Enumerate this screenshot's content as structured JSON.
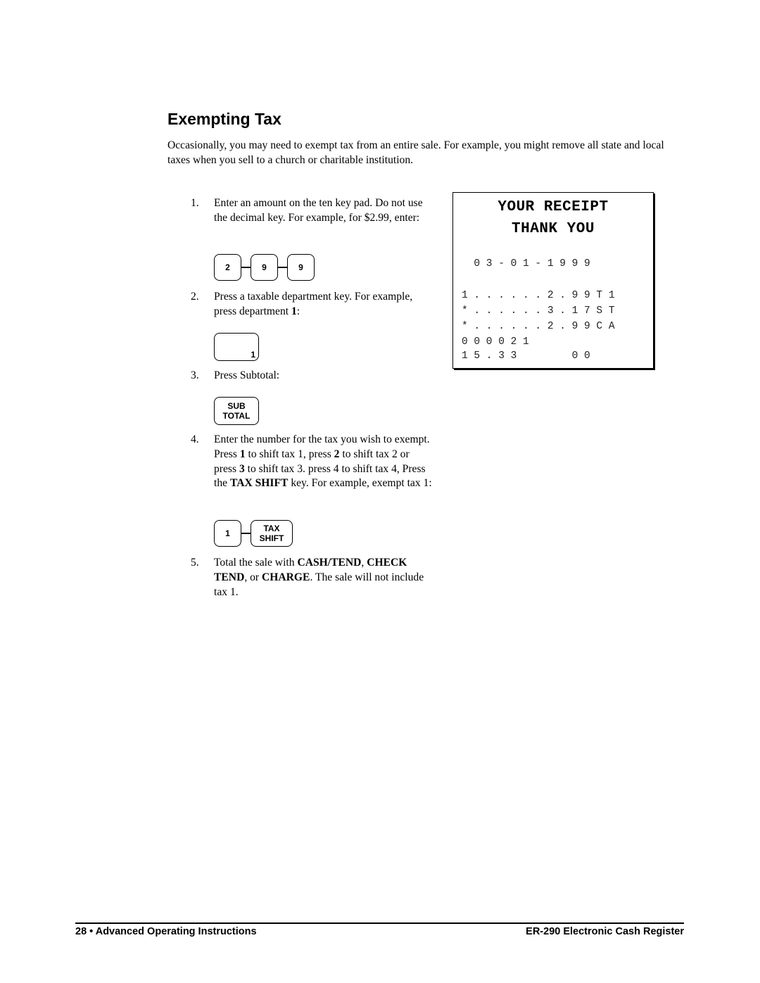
{
  "page": {
    "title": "Exempting Tax",
    "intro": "Occasionally, you may need to exempt tax from an entire sale.  For example, you might remove all state and local taxes when you sell to a church or charitable institution."
  },
  "steps": [
    {
      "number": "1.",
      "text_parts": [
        "Enter an amount on the ten key pad.  Do not use the decimal key.  For example, for $2.99, enter:"
      ],
      "keys": [
        "2",
        "9",
        "9"
      ]
    },
    {
      "number": "2.",
      "text_parts": [
        "Press a taxable department key.  For example, press department ",
        "1",
        ":"
      ],
      "keys": [
        "1"
      ]
    },
    {
      "number": "3.",
      "text_parts": [
        "Press Subtotal:"
      ],
      "keys": [
        "SUB TOTAL"
      ],
      "key_lines": [
        "SUB",
        "TOTAL"
      ]
    },
    {
      "number": "4.",
      "text_parts": [
        "Enter the number for the tax you wish to exempt. Press ",
        "1",
        " to shift tax 1, press ",
        "2",
        " to shift tax 2 or press ",
        "3",
        " to shift tax 3. press 4 to shift tax 4,  Press the ",
        "TAX SHIFT",
        " key. For example, exempt tax 1:"
      ],
      "keys": [
        "1",
        "TAX SHIFT"
      ],
      "key_lines": [
        "TAX",
        "SHIFT"
      ]
    },
    {
      "number": "5.",
      "text_parts": [
        "Total the sale with ",
        "CASH/TEND",
        ", ",
        "CHECK TEND",
        ", or ",
        "CHARGE",
        ".  The sale will not include tax 1."
      ]
    }
  ],
  "receipt": {
    "header_line1": "YOUR RECEIPT",
    "header_line2": "THANK YOU",
    "date": "  0 3 - 0 1 - 1 9 9 9",
    "lines": [
      "1 . . . . . . 2 . 9 9 T 1",
      "* . . . . . . 3 . 1 7 S T",
      "* . . . . . . 2 . 9 9 C A",
      "0 0 0 0 2 1",
      "1 5 . 3 3         0 0"
    ]
  },
  "footer": {
    "left": "28 • Advanced Operating Instructions",
    "right": "ER-290 Electronic Cash Register"
  }
}
